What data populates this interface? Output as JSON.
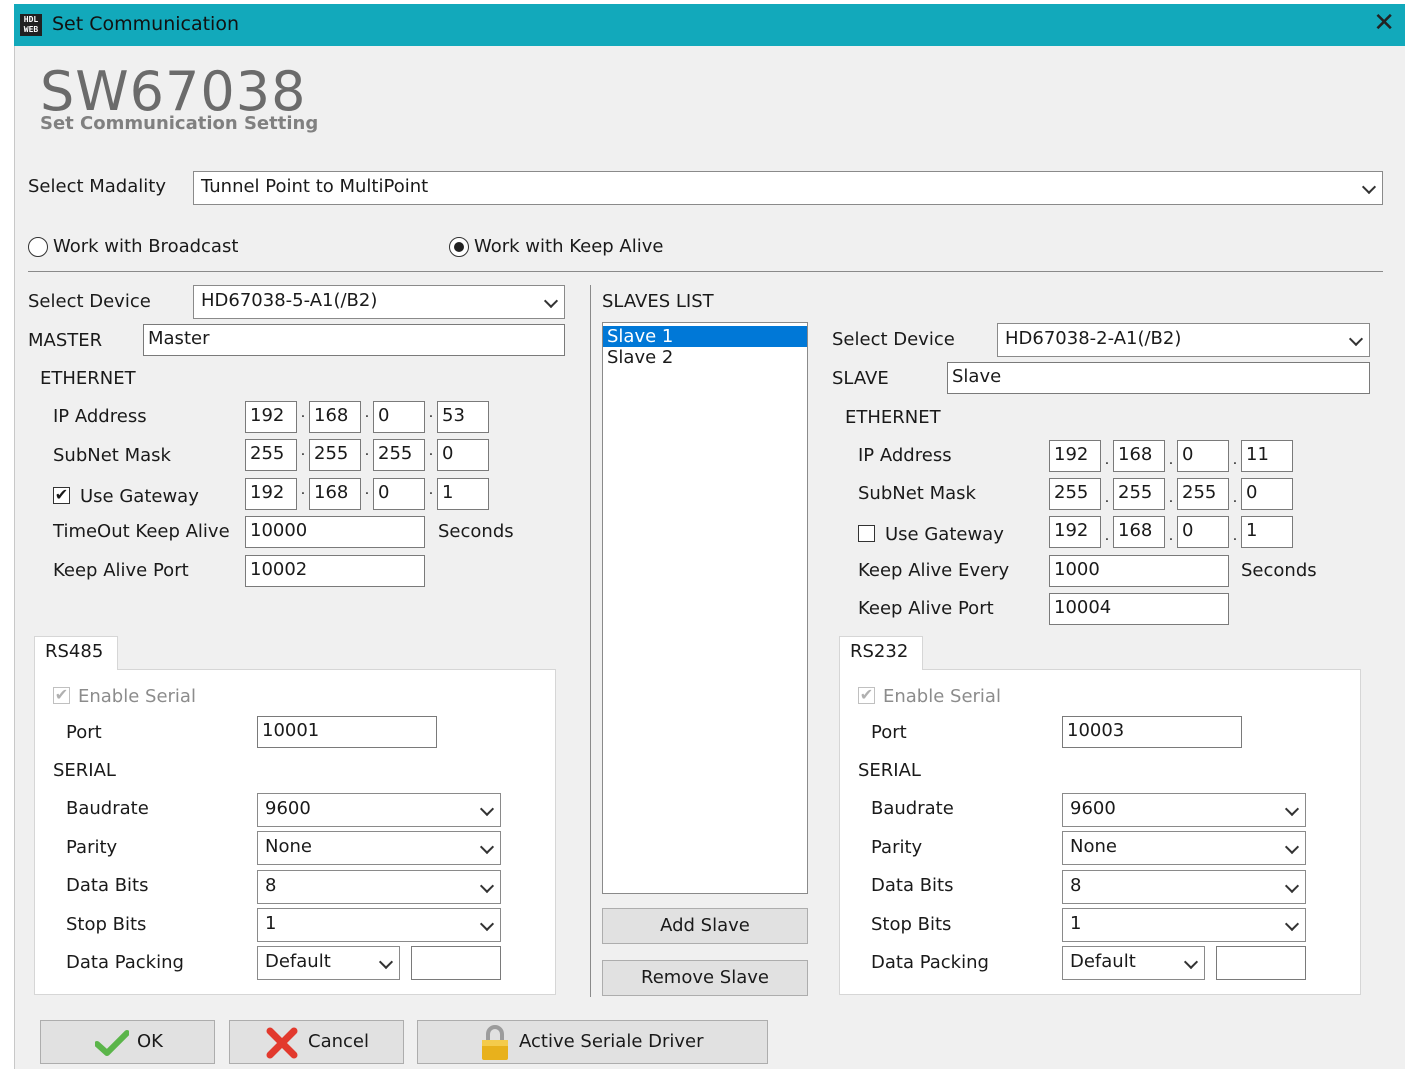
{
  "window": {
    "title": "Set Communication",
    "icon_text": "HDL WEB"
  },
  "header": {
    "title": "SW67038",
    "subtitle": "Set Communication Setting"
  },
  "modality": {
    "label": "Select Madality",
    "value": "Tunnel Point to MultiPoint"
  },
  "mode": {
    "broadcast_label": "Work with Broadcast",
    "keepalive_label": "Work with Keep Alive",
    "selected": "keepalive"
  },
  "master": {
    "select_device_label": "Select Device",
    "device": "HD67038-5-A1(/B2)",
    "name_label": "MASTER",
    "name": "Master",
    "ethernet_label": "ETHERNET",
    "ip_label": "IP Address",
    "ip": [
      "192",
      "168",
      "0",
      "53"
    ],
    "subnet_label": "SubNet Mask",
    "subnet": [
      "255",
      "255",
      "255",
      "0"
    ],
    "gateway_label": "Use Gateway",
    "gateway_checked": true,
    "gateway": [
      "192",
      "168",
      "0",
      "1"
    ],
    "timeout_label": "TimeOut Keep Alive",
    "timeout": "10000",
    "seconds_label": "Seconds",
    "keepalive_port_label": "Keep Alive Port",
    "keepalive_port": "10002",
    "serial_tab": "RS485",
    "enable_serial_label": "Enable Serial",
    "port_label": "Port",
    "port": "10001",
    "serial_label": "SERIAL",
    "baudrate_label": "Baudrate",
    "baudrate": "9600",
    "parity_label": "Parity",
    "parity": "None",
    "databits_label": "Data Bits",
    "databits": "8",
    "stopbits_label": "Stop Bits",
    "stopbits": "1",
    "datapacking_label": "Data Packing",
    "datapacking": "Default",
    "datapacking_extra": ""
  },
  "slaves": {
    "list_label": "SLAVES LIST",
    "items": [
      "Slave 1",
      "Slave 2"
    ],
    "selected_index": 0,
    "add_label": "Add Slave",
    "remove_label": "Remove Slave"
  },
  "slave": {
    "select_device_label": "Select Device",
    "device": "HD67038-2-A1(/B2)",
    "name_label": "SLAVE",
    "name": "Slave",
    "ethernet_label": "ETHERNET",
    "ip_label": "IP Address",
    "ip": [
      "192",
      "168",
      "0",
      "11"
    ],
    "subnet_label": "SubNet Mask",
    "subnet": [
      "255",
      "255",
      "255",
      "0"
    ],
    "gateway_label": "Use Gateway",
    "gateway_checked": false,
    "gateway": [
      "192",
      "168",
      "0",
      "1"
    ],
    "keepalive_every_label": "Keep Alive Every",
    "keepalive_every": "1000",
    "seconds_label": "Seconds",
    "keepalive_port_label": "Keep Alive Port",
    "keepalive_port": "10004",
    "serial_tab": "RS232",
    "enable_serial_label": "Enable Serial",
    "port_label": "Port",
    "port": "10003",
    "serial_label": "SERIAL",
    "baudrate_label": "Baudrate",
    "baudrate": "9600",
    "parity_label": "Parity",
    "parity": "None",
    "databits_label": "Data Bits",
    "databits": "8",
    "stopbits_label": "Stop Bits",
    "stopbits": "1",
    "datapacking_label": "Data Packing",
    "datapacking": "Default",
    "datapacking_extra": ""
  },
  "footer": {
    "ok_label": "OK",
    "cancel_label": "Cancel",
    "driver_label": "Active Seriale Driver"
  },
  "colors": {
    "titlebar": "#12a9bb",
    "selection": "#0078d7",
    "window_bg": "#f0f0f0",
    "ok_check": "#5bb54a",
    "cancel_x": "#e2392d",
    "lock": "#e8b11c"
  }
}
